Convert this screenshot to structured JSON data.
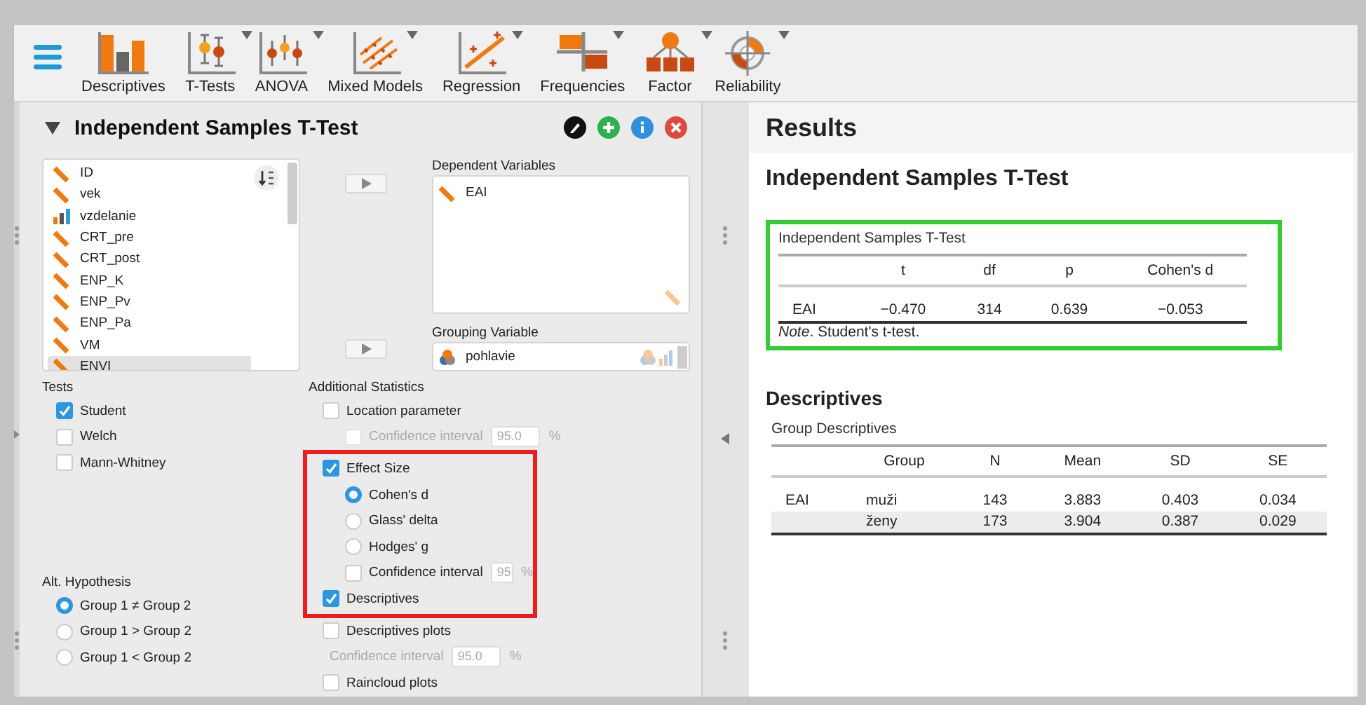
{
  "toolbar": {
    "items": [
      {
        "label": "Descriptives",
        "dropdown": false
      },
      {
        "label": "T-Tests",
        "dropdown": true
      },
      {
        "label": "ANOVA",
        "dropdown": true
      },
      {
        "label": "Mixed Models",
        "dropdown": true
      },
      {
        "label": "Regression",
        "dropdown": true
      },
      {
        "label": "Frequencies",
        "dropdown": true
      },
      {
        "label": "Factor",
        "dropdown": true
      },
      {
        "label": "Reliability",
        "dropdown": true
      }
    ]
  },
  "analysis": {
    "title": "Independent Samples T-Test",
    "expanded": true,
    "variables": [
      {
        "name": "ID",
        "kind": "scale",
        "selected": false
      },
      {
        "name": "vek",
        "kind": "scale",
        "selected": false
      },
      {
        "name": "vzdelanie",
        "kind": "ordinal",
        "selected": false
      },
      {
        "name": "CRT_pre",
        "kind": "scale",
        "selected": false
      },
      {
        "name": "CRT_post",
        "kind": "scale",
        "selected": false
      },
      {
        "name": "ENP_K",
        "kind": "scale",
        "selected": false
      },
      {
        "name": "ENP_Pv",
        "kind": "scale",
        "selected": false
      },
      {
        "name": "ENP_Pa",
        "kind": "scale",
        "selected": false
      },
      {
        "name": "VM",
        "kind": "scale",
        "selected": false
      },
      {
        "name": "ENVI",
        "kind": "scale",
        "selected": true
      }
    ],
    "dependent": {
      "label": "Dependent Variables",
      "items": [
        {
          "name": "EAI",
          "kind": "scale"
        }
      ]
    },
    "grouping": {
      "label": "Grouping Variable",
      "items": [
        {
          "name": "pohlavie",
          "kind": "nominal"
        }
      ]
    },
    "tests": {
      "label": "Tests",
      "options": [
        {
          "label": "Student",
          "checked": true
        },
        {
          "label": "Welch",
          "checked": false
        },
        {
          "label": "Mann-Whitney",
          "checked": false
        }
      ]
    },
    "alt_hypothesis": {
      "label": "Alt. Hypothesis",
      "options": [
        {
          "label": "Group 1 ≠ Group 2",
          "selected": true
        },
        {
          "label": "Group 1 > Group 2",
          "selected": false
        },
        {
          "label": "Group 1 < Group 2",
          "selected": false
        }
      ]
    },
    "additional": {
      "label": "Additional Statistics",
      "items": [
        {
          "kind": "checkbox",
          "label": "Location parameter",
          "checked": false,
          "disabled": false,
          "children": [
            {
              "kind": "interval",
              "label": "Confidence interval",
              "checked": false,
              "disabled": true,
              "value": "95.0",
              "unit": "%"
            }
          ]
        },
        {
          "kind": "group",
          "color": "#ee1c1c",
          "children": [
            {
              "kind": "checkbox",
              "label": "Effect Size",
              "checked": true,
              "disabled": false,
              "children": [
                {
                  "kind": "radio",
                  "label": "Cohen's d",
                  "selected": true
                },
                {
                  "kind": "radio",
                  "label": "Glass' delta",
                  "selected": false
                },
                {
                  "kind": "radio",
                  "label": "Hodges' g",
                  "selected": false
                },
                {
                  "kind": "interval",
                  "label": "Confidence interval",
                  "checked": false,
                  "disabled": false,
                  "value": "95",
                  "unit": "%"
                }
              ]
            },
            {
              "kind": "checkbox",
              "label": "Descriptives",
              "checked": true,
              "disabled": false
            }
          ]
        },
        {
          "kind": "checkbox",
          "label": "Descriptives plots",
          "checked": false,
          "disabled": false,
          "children": [
            {
              "kind": "field",
              "label": "Confidence interval",
              "disabled": true,
              "value": "95.0",
              "unit": "%"
            }
          ]
        },
        {
          "kind": "checkbox",
          "label": "Raincloud plots",
          "checked": false,
          "disabled": false
        }
      ]
    }
  },
  "results": {
    "title": "Results",
    "sections": [
      {
        "heading": "Independent Samples T-Test",
        "tables": [
          {
            "title": "Independent Samples T-Test",
            "color": "#33cc33",
            "columns": [
              "",
              "t",
              "df",
              "p",
              "Cohen's d"
            ],
            "rows": [
              [
                "EAI",
                "−0.470",
                "314",
                "0.639",
                "−0.053"
              ]
            ],
            "note": "*Note*. Student's t-test."
          }
        ]
      },
      {
        "heading": "Descriptives",
        "tables": [
          {
            "title": "Group Descriptives",
            "columns": [
              "",
              "Group",
              "N",
              "Mean",
              "SD",
              "SE"
            ],
            "rows": [
              [
                "EAI",
                "muži",
                "143",
                "3.883",
                "0.403",
                "0.034"
              ],
              [
                "",
                "ženy",
                "173",
                "3.904",
                "0.387",
                "0.029"
              ]
            ]
          }
        ]
      }
    ]
  }
}
